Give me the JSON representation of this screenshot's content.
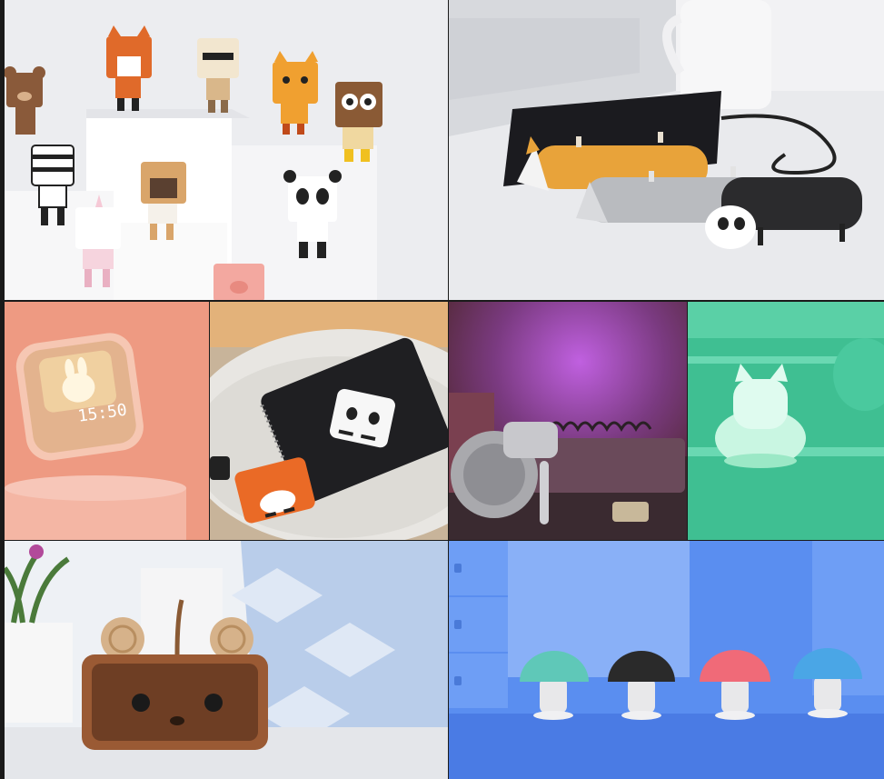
{
  "tiles": [
    {
      "name": "animal-figures"
    },
    {
      "name": "animal-power-banks"
    },
    {
      "name": "bunny-alarm-clock"
    },
    {
      "name": "pocket-power-banks"
    },
    {
      "name": "astronaut-projector"
    },
    {
      "name": "cat-night-light"
    },
    {
      "name": "monkey-speaker"
    },
    {
      "name": "mushroom-speakers"
    }
  ],
  "clock": {
    "time": "15:50"
  },
  "colors": {
    "coral": "#ee9a82",
    "teal": "#3fbf92",
    "blue": "#5a8ef0",
    "mushroom_teal": "#5fc8b8",
    "mushroom_black": "#2a2a2a",
    "mushroom_pink": "#f06a78",
    "mushroom_blue": "#4aa6e6"
  }
}
